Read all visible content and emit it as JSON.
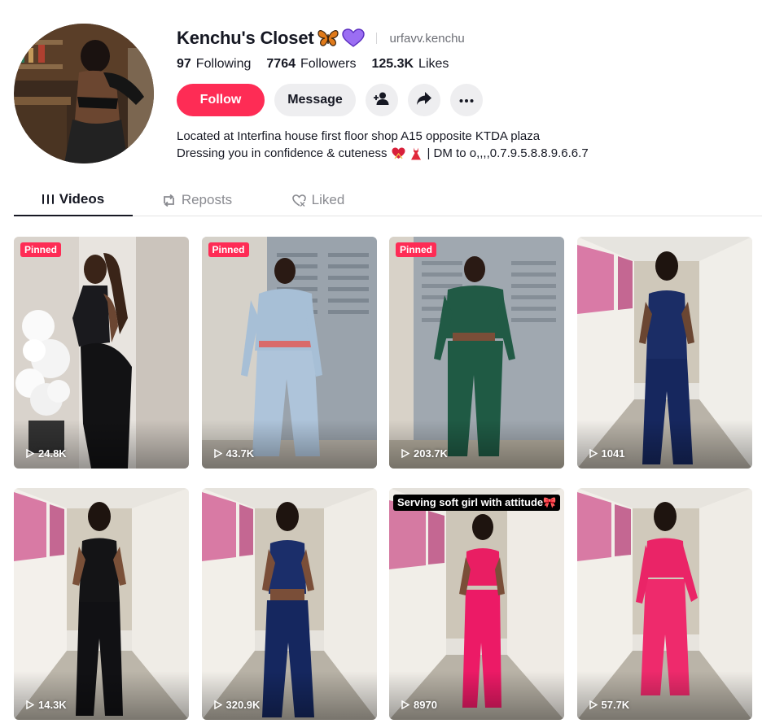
{
  "profile": {
    "display_name": "Kenchu's Closet",
    "username": "urfavv.kenchu",
    "emojis": [
      "butterfly-icon",
      "purple-heart-icon"
    ]
  },
  "stats": {
    "following_count": "97",
    "following_label": "Following",
    "followers_count": "7764",
    "followers_label": "Followers",
    "likes_count": "125.3K",
    "likes_label": "Likes"
  },
  "actions": {
    "follow_label": "Follow",
    "message_label": "Message"
  },
  "bio": {
    "line1": "Located at Interfina house first floor shop A15 opposite KTDA plaza",
    "line2_a": "Dressing you in confidence & cuteness",
    "line2_b": "| DM to o,,,,0.7.9.5.8.8.9.6.6.7"
  },
  "tabs": [
    {
      "label": "Videos",
      "active": true
    },
    {
      "label": "Reposts",
      "active": false
    },
    {
      "label": "Liked",
      "active": false
    }
  ],
  "videos": [
    {
      "views": "24.8K",
      "badge": "Pinned"
    },
    {
      "views": "43.7K",
      "badge": "Pinned"
    },
    {
      "views": "203.7K",
      "badge": "Pinned"
    },
    {
      "views": "1041"
    },
    {
      "views": "14.3K"
    },
    {
      "views": "320.9K"
    },
    {
      "views": "8970",
      "caption": "Serving soft girl with attitude🎀"
    },
    {
      "views": "57.7K"
    }
  ],
  "colors": {
    "accent": "#fe2c55",
    "text": "#161823",
    "muted": "#8a8b91",
    "button_bg": "#eeeef0"
  }
}
